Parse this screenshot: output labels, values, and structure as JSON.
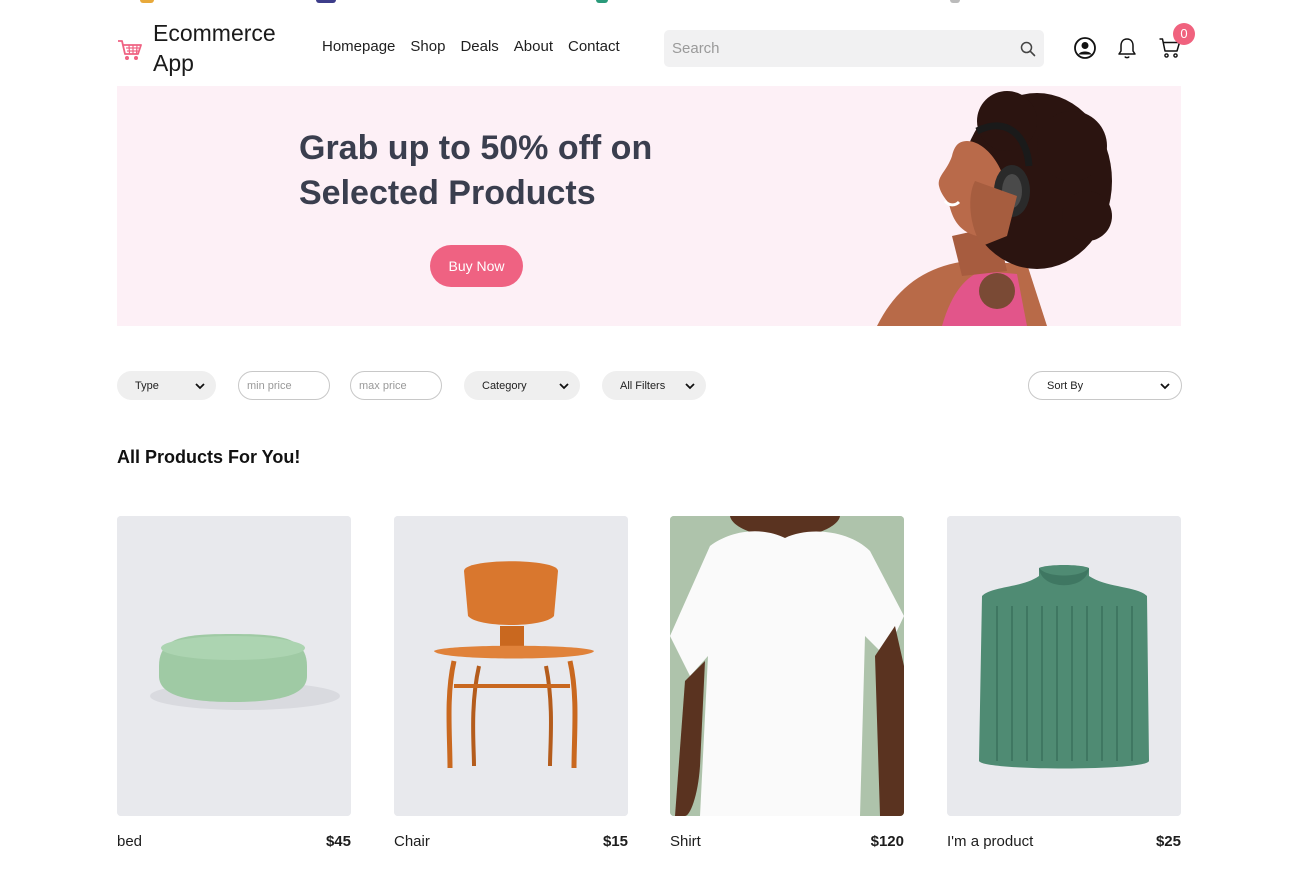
{
  "header": {
    "app_name": "Ecommerce App",
    "nav": [
      "Homepage",
      "Shop",
      "Deals",
      "About",
      "Contact"
    ],
    "search_placeholder": "Search",
    "cart_count": "0",
    "icons": [
      "cart-logo-icon",
      "search-icon",
      "user-icon",
      "bell-icon",
      "cart-icon"
    ]
  },
  "hero": {
    "title": "Grab up to 50% off on Selected Products",
    "button": "Buy Now"
  },
  "filters": {
    "type": "Type",
    "min_price_placeholder": "min price",
    "max_price_placeholder": "max price",
    "category": "Category",
    "all_filters": "All Filters",
    "sort_by": "Sort By"
  },
  "products_section": {
    "title": "All Products For You!",
    "items": [
      {
        "name": "bed",
        "price": "$45"
      },
      {
        "name": "Chair",
        "price": "$15"
      },
      {
        "name": "Shirt",
        "price": "$120"
      },
      {
        "name": "I'm a product",
        "price": "$25"
      }
    ]
  },
  "colors": {
    "accent": "#ef6282",
    "hero_bg": "#fdf0f6",
    "heading": "#3a3e4e"
  }
}
